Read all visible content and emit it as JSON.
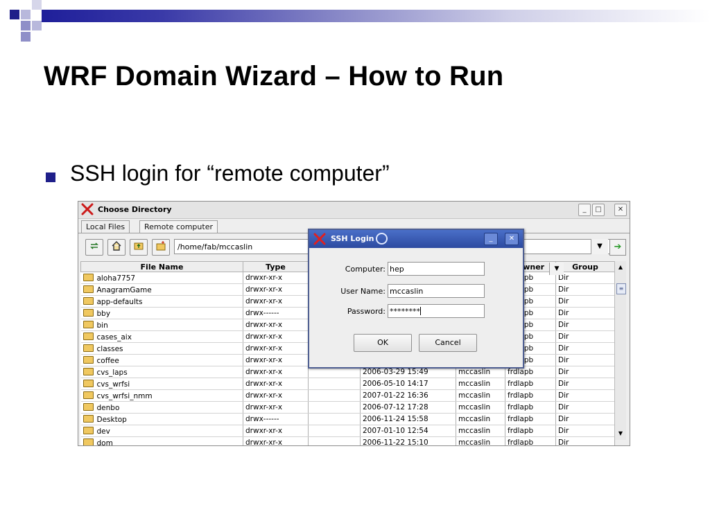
{
  "slide": {
    "title": "WRF Domain Wizard – How to Run",
    "bullet": "SSH login for “remote computer”",
    "accent_color": "#1f1f8a"
  },
  "window": {
    "title": "Choose Directory",
    "logo_icon": "x-logo-icon",
    "controls": {
      "minimize": "_",
      "maximize": "□",
      "close": "✕"
    }
  },
  "tabs": [
    {
      "label": "Local Files",
      "active": true
    },
    {
      "label": "Remote computer",
      "active": false
    }
  ],
  "toolbar": {
    "buttons": [
      "refresh-icon",
      "home-icon",
      "folder-up-icon",
      "new-folder-icon"
    ],
    "path": "/home/fab/mccaslin",
    "go_icon": "go-arrow-icon"
  },
  "table": {
    "columns": [
      "File Name",
      "Type",
      "",
      "",
      "Owner",
      "Group"
    ],
    "rows": [
      {
        "name": "aloha7757",
        "type": "drwxr-xr-x",
        "date": "",
        "user": "",
        "owner": "frdlapb",
        "group": "Dir"
      },
      {
        "name": "AnagramGame",
        "type": "drwxr-xr-x",
        "date": "",
        "user": "",
        "owner": "frdlapb",
        "group": "Dir"
      },
      {
        "name": "app-defaults",
        "type": "drwxr-xr-x",
        "date": "",
        "user": "",
        "owner": "frdlapb",
        "group": "Dir"
      },
      {
        "name": "bby",
        "type": "drwx------",
        "date": "",
        "user": "",
        "owner": "frdlapb",
        "group": "Dir"
      },
      {
        "name": "bin",
        "type": "drwxr-xr-x",
        "date": "",
        "user": "",
        "owner": "frdlapb",
        "group": "Dir"
      },
      {
        "name": "cases_aix",
        "type": "drwxr-xr-x",
        "date": "",
        "user": "",
        "owner": "frdlapb",
        "group": "Dir"
      },
      {
        "name": "classes",
        "type": "drwxr-xr-x",
        "date": "",
        "user": "",
        "owner": "frdlapb",
        "group": "Dir"
      },
      {
        "name": "coffee",
        "type": "drwxr-xr-x",
        "date": "",
        "user": "",
        "owner": "frdlapb",
        "group": "Dir"
      },
      {
        "name": "cvs_laps",
        "type": "drwxr-xr-x",
        "date": "2006-03-29 15:49",
        "user": "mccaslin",
        "owner": "frdlapb",
        "group": "Dir"
      },
      {
        "name": "cvs_wrfsi",
        "type": "drwxr-xr-x",
        "date": "2006-05-10 14:17",
        "user": "mccaslin",
        "owner": "frdlapb",
        "group": "Dir"
      },
      {
        "name": "cvs_wrfsi_nmm",
        "type": "drwxr-xr-x",
        "date": "2007-01-22 16:36",
        "user": "mccaslin",
        "owner": "frdlapb",
        "group": "Dir"
      },
      {
        "name": "denbo",
        "type": "drwxr-xr-x",
        "date": "2006-07-12 17:28",
        "user": "mccaslin",
        "owner": "frdlapb",
        "group": "Dir"
      },
      {
        "name": "Desktop",
        "type": "drwx------",
        "date": "2006-11-24 15:58",
        "user": "mccaslin",
        "owner": "frdlapb",
        "group": "Dir"
      },
      {
        "name": "dev",
        "type": "drwxr-xr-x",
        "date": "2007-01-10 12:54",
        "user": "mccaslin",
        "owner": "frdlapb",
        "group": "Dir"
      },
      {
        "name": "dom",
        "type": "drwxr-xr-x",
        "date": "2006-11-22 15:10",
        "user": "mccaslin",
        "owner": "frdlapb",
        "group": "Dir"
      }
    ]
  },
  "dialog": {
    "title": "SSH Login",
    "computer_label": "Computer:",
    "computer_value": "hep",
    "username_label": "User Name:",
    "username_value": "mccaslin",
    "password_label": "Password:",
    "password_value": "********",
    "ok_label": "OK",
    "cancel_label": "Cancel",
    "title_bar_color": "#3355aa"
  }
}
